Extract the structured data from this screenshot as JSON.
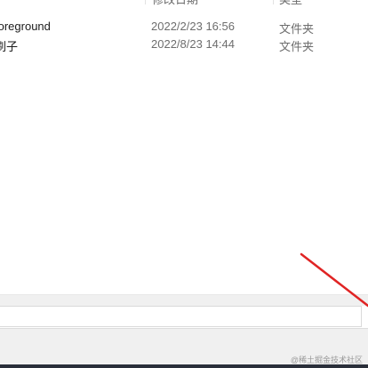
{
  "columns": {
    "modified": "修改日期",
    "type": "类型"
  },
  "rows": [
    {
      "name": "foreground",
      "date": "2022/2/23 16:56",
      "type": "文件夹"
    },
    {
      "name": "刷子",
      "date": "2022/8/23 14:44",
      "type": "文件夹"
    }
  ],
  "file_name_input": {
    "value": ""
  },
  "annotation": {
    "color": "#e02424"
  },
  "watermark": "@稀土掘金技术社区"
}
